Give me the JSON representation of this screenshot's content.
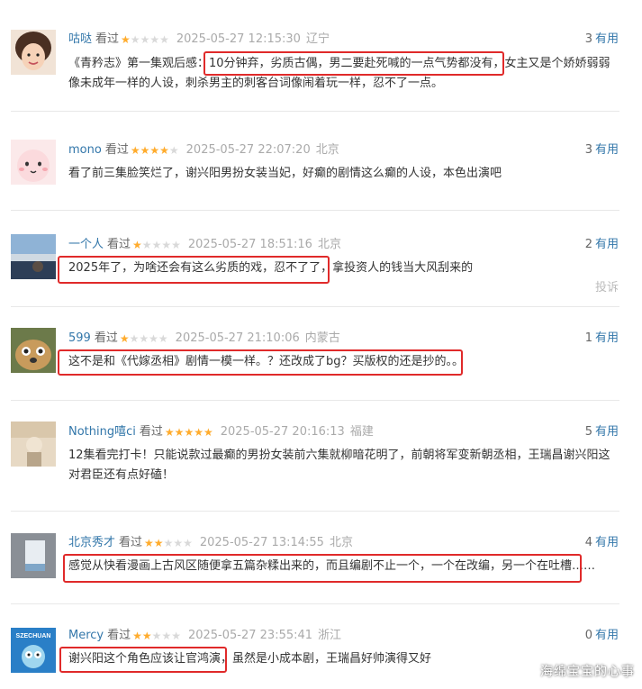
{
  "reviews": [
    {
      "user": "咕哒",
      "status": "看过",
      "rating": 1,
      "time": "2025-05-27 12:15:30",
      "location": "辽宁",
      "votes": "3",
      "votes_label": "有用",
      "content": "《青矜志》第一集观后感：10分钟弃，劣质古偶，男二要赴死喊的一点气势都没有，女主又是个娇娇弱弱像未成年一样的人设，刺杀男主的刺客台词像闹着玩一样，忍不了一点。"
    },
    {
      "user": "mono",
      "status": "看过",
      "rating": 4,
      "time": "2025-05-27 22:07:20",
      "location": "北京",
      "votes": "3",
      "votes_label": "有用",
      "content": "看了前三集脸笑烂了，谢兴阳男扮女装当妃，好癫的剧情这么癫的人设，本色出演吧"
    },
    {
      "user": "一个人",
      "status": "看过",
      "rating": 1,
      "time": "2025-05-27 18:51:16",
      "location": "北京",
      "votes": "2",
      "votes_label": "有用",
      "content": "2025年了，为啥还会有这么劣质的戏，忍不了了，拿投资人的钱当大风刮来的",
      "report": "投诉"
    },
    {
      "user": "599",
      "status": "看过",
      "rating": 1,
      "time": "2025-05-27 21:10:06",
      "location": "内蒙古",
      "votes": "1",
      "votes_label": "有用",
      "content": "这不是和《代嫁丞相》剧情一模一样。？还改成了bg？买版权的还是抄的。。"
    },
    {
      "user": "Nothing嘻ci",
      "status": "看过",
      "rating": 5,
      "time": "2025-05-27 20:16:13",
      "location": "福建",
      "votes": "5",
      "votes_label": "有用",
      "content": "12集看完打卡！只能说款过最癫的男扮女装前六集就柳暗花明了，前朝将军变新朝丞相，王瑞昌谢兴阳这对君臣还有点好磕！"
    },
    {
      "user": "北京秀才",
      "status": "看过",
      "rating": 2,
      "time": "2025-05-27 13:14:55",
      "location": "北京",
      "votes": "4",
      "votes_label": "有用",
      "content": "感觉从快看漫画上古风区随便拿五篇杂糅出来的，而且编剧不止一个，一个在改编，另一个在吐槽……"
    },
    {
      "user": "Mercy",
      "status": "看过",
      "rating": 2,
      "time": "2025-05-27 23:55:41",
      "location": "浙江",
      "votes": "0",
      "votes_label": "有用",
      "content": "谢兴阳这个角色应该让官鸿演，虽然是小成本剧，王瑞昌好帅演得又好"
    }
  ],
  "avatar_logo_text": "SZECHUAN",
  "watermark": "海绵宝宝的心事",
  "colors": {
    "link": "#3377aa",
    "star": "#ffac2d",
    "highlight": "#e02a2a"
  }
}
